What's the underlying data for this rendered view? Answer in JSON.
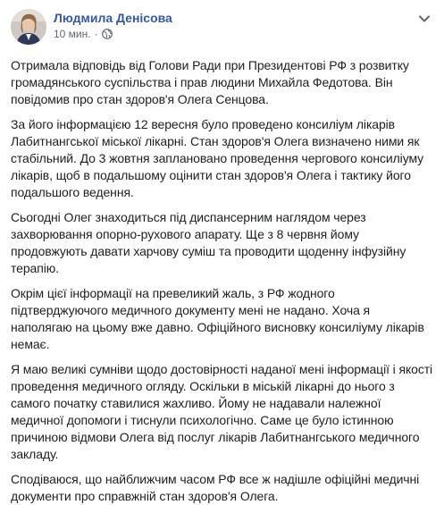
{
  "post": {
    "author": "Людмила Денісова",
    "time": "10 мин.",
    "separator": "·",
    "privacy_icon": "globe-icon",
    "menu_icon": "chevron-down-icon",
    "avatar_icon": "avatar",
    "colors": {
      "author": "#385898",
      "meta": "#616770",
      "text": "#1c1e21"
    },
    "paragraphs": [
      "Отримала відповідь від Голови Ради при Президентові РФ з розвитку громадянського суспільства і прав людини Михайла Федотова. Він повідомив про стан здоров'я Олега Сенцова.",
      "За його інформацією 12 вересня було проведено консиліум лікарів Лабитнангської міської лікарні. Стан здоров'я Олега визначено ними як стабільний. До 3 жовтня заплановано проведення чергового консиліуму лікарів, щоб в подальшому оцінити стан здоров'я Олега і тактику його подальшого ведення.",
      "Сьогодні Олег знаходиться під диспансерним наглядом через захворювання опорно-рухового апарату. Ще з 8 червня йому продовжують давати харчову суміш та проводити щоденну інфузійну терапію.",
      "Окрім цієї інформації на превеликий жаль, з РФ жодного підтверджуючого медичного документу мені не надано. Хоча я наполягаю на цьому вже давно. Офіційного висновку консиліуму лікарів немає.",
      "Я маю великі сумніви щодо достовірності наданої мені інформації і якості проведення медичного огляду. Оскільки в міській лікарні до нього з самого початку ставилися жахливо. Йому не надавали належної медичної допомоги і тиснули психологічно. Саме це було істинною причиною відмови Олега від послуг лікарів Лабитнангського медичного закладу.",
      "Сподіваюся, що найближчим часом РФ все ж надішле офіційні медичні документи про справжній стан здоров'я Олега."
    ]
  }
}
